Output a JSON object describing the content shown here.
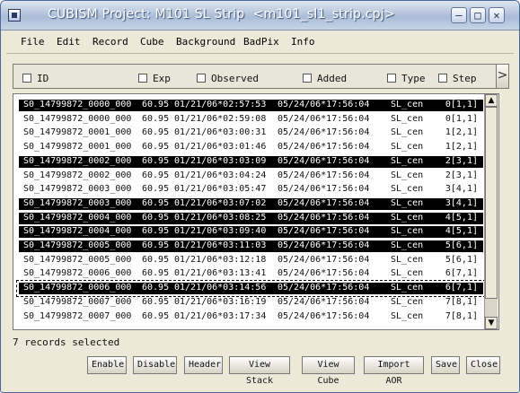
{
  "window": {
    "title": "CUBISM Project: M101 SL Strip  <m101_sl1_strip.cpj>",
    "minimize_label": "–",
    "maximize_label": "□",
    "close_label": "✕"
  },
  "menu": [
    "File",
    "Edit",
    "Record",
    "Cube",
    "Background",
    "BadPix",
    "Info"
  ],
  "columns": [
    "ID",
    "Exp",
    "Observed",
    "Added",
    "Type",
    "Step"
  ],
  "column_scroll_label": ">",
  "rows": [
    {
      "id": "S0_14799872_0000_000",
      "exp": "60.95",
      "observed": "01/21/06*02:57:53",
      "added": "05/24/06*17:56:04",
      "type": "SL_cen",
      "step": "0[1,1]",
      "selected": true
    },
    {
      "id": "S0_14799872_0000_000",
      "exp": "60.95",
      "observed": "01/21/06*02:59:08",
      "added": "05/24/06*17:56:04",
      "type": "SL_cen",
      "step": "0[1,1]",
      "selected": false
    },
    {
      "id": "S0_14799872_0001_000",
      "exp": "60.95",
      "observed": "01/21/06*03:00:31",
      "added": "05/24/06*17:56:04",
      "type": "SL_cen",
      "step": "1[2,1]",
      "selected": false
    },
    {
      "id": "S0_14799872_0001_000",
      "exp": "60.95",
      "observed": "01/21/06*03:01:46",
      "added": "05/24/06*17:56:04",
      "type": "SL_cen",
      "step": "1[2,1]",
      "selected": false
    },
    {
      "id": "S0_14799872_0002_000",
      "exp": "60.95",
      "observed": "01/21/06*03:03:09",
      "added": "05/24/06*17:56:04",
      "type": "SL_cen",
      "step": "2[3,1]",
      "selected": true
    },
    {
      "id": "S0_14799872_0002_000",
      "exp": "60.95",
      "observed": "01/21/06*03:04:24",
      "added": "05/24/06*17:56:04",
      "type": "SL_cen",
      "step": "2[3,1]",
      "selected": false
    },
    {
      "id": "S0_14799872_0003_000",
      "exp": "60.95",
      "observed": "01/21/06*03:05:47",
      "added": "05/24/06*17:56:04",
      "type": "SL_cen",
      "step": "3[4,1]",
      "selected": false
    },
    {
      "id": "S0_14799872_0003_000",
      "exp": "60.95",
      "observed": "01/21/06*03:07:02",
      "added": "05/24/06*17:56:04",
      "type": "SL_cen",
      "step": "3[4,1]",
      "selected": true
    },
    {
      "id": "S0_14799872_0004_000",
      "exp": "60.95",
      "observed": "01/21/06*03:08:25",
      "added": "05/24/06*17:56:04",
      "type": "SL_cen",
      "step": "4[5,1]",
      "selected": true
    },
    {
      "id": "S0_14799872_0004_000",
      "exp": "60.95",
      "observed": "01/21/06*03:09:40",
      "added": "05/24/06*17:56:04",
      "type": "SL_cen",
      "step": "4[5,1]",
      "selected": true
    },
    {
      "id": "S0_14799872_0005_000",
      "exp": "60.95",
      "observed": "01/21/06*03:11:03",
      "added": "05/24/06*17:56:04",
      "type": "SL_cen",
      "step": "5[6,1]",
      "selected": true
    },
    {
      "id": "S0_14799872_0005_000",
      "exp": "60.95",
      "observed": "01/21/06*03:12:18",
      "added": "05/24/06*17:56:04",
      "type": "SL_cen",
      "step": "5[6,1]",
      "selected": false
    },
    {
      "id": "S0_14799872_0006_000",
      "exp": "60.95",
      "observed": "01/21/06*03:13:41",
      "added": "05/24/06*17:56:04",
      "type": "SL_cen",
      "step": "6[7,1]",
      "selected": false
    },
    {
      "id": "S0_14799872_0006_000",
      "exp": "60.95",
      "observed": "01/21/06*03:14:56",
      "added": "05/24/06*17:56:04",
      "type": "SL_cen",
      "step": "6[7,1]",
      "selected": true,
      "focused": true
    },
    {
      "id": "S0_14799872_0007_000",
      "exp": "60.95",
      "observed": "01/21/06*03:16:19",
      "added": "05/24/06*17:56:04",
      "type": "SL_cen",
      "step": "7[8,1]",
      "selected": false
    },
    {
      "id": "S0_14799872_0007_000",
      "exp": "60.95",
      "observed": "01/21/06*03:17:34",
      "added": "05/24/06*17:56:04",
      "type": "SL_cen",
      "step": "7[8,1]",
      "selected": false
    }
  ],
  "scrollbar": {
    "up": "▲",
    "down": "▼"
  },
  "status": "7 records selected",
  "buttons": [
    "Enable",
    "Disable",
    "Header",
    "View Stack",
    "View Cube",
    "Import AOR",
    "Save",
    "Close"
  ],
  "colors": {
    "selection": "#000000",
    "window_face": "#ece9d8",
    "titlebar": "#a9bcd6"
  }
}
